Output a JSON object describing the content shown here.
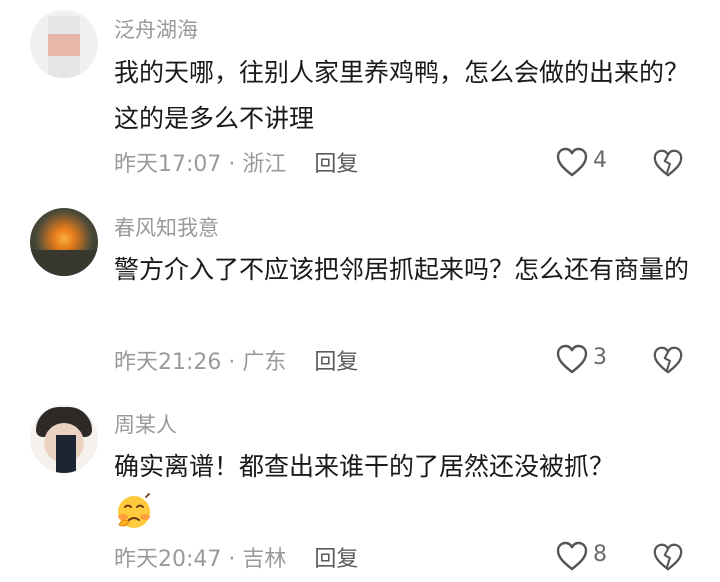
{
  "comments": [
    {
      "username": "泛舟湖海",
      "text": "我的天哪，往别人家里养鸡鸭，怎么会做的出来的？这的是多么不讲理",
      "time": "昨天17:07",
      "location": "浙江",
      "reply_label": "回复",
      "likes": "4"
    },
    {
      "username": "春风知我意",
      "text": "警方介入了不应该把邻居抓起来吗？怎么还有商量的",
      "time": "昨天21:26",
      "location": "广东",
      "reply_label": "回复",
      "likes": "3"
    },
    {
      "username": "周某人",
      "text": "确实离谱！都查出来谁干的了居然还没被抓？",
      "time": "昨天20:47",
      "location": "吉林",
      "reply_label": "回复",
      "likes": "8"
    }
  ],
  "separator": " · ",
  "icons": {
    "like": "heart-outline-icon",
    "dislike": "broken-heart-icon",
    "emoji": "worried-emoji"
  },
  "colors": {
    "username": "#9a9a9a",
    "text": "#1a1a1a",
    "meta": "#9a9a9a",
    "reply": "#5c5c5c",
    "icon": "#555555"
  }
}
